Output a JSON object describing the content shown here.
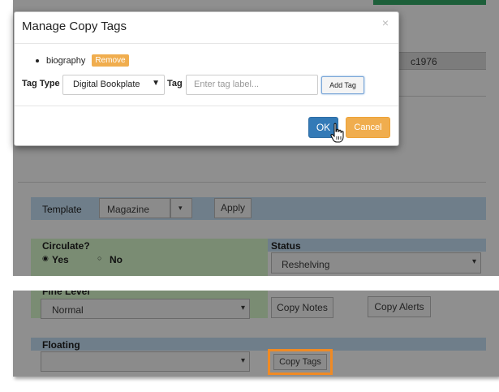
{
  "modal": {
    "title": "Manage Copy Tags",
    "close": "×",
    "tag": {
      "label": "biography",
      "remove": "Remove"
    },
    "tag_type_label": "Tag Type",
    "tag_type_value": "Digital Bookplate",
    "tag_label": "Tag",
    "tag_placeholder": "Enter tag label...",
    "add_tag": "Add Tag",
    "ok": "OK",
    "cancel": "Cancel"
  },
  "background": {
    "grid_value": "c1976",
    "template_label": "Template",
    "template_value": "Magazine",
    "apply": "Apply",
    "circulate_label": "Circulate?",
    "yes": "Yes",
    "no": "No",
    "status_label": "Status",
    "status_value": "Reshelving",
    "fine_level_label": "Fine Level",
    "fine_level_value": "Normal",
    "copy_notes": "Copy Notes",
    "copy_alerts": "Copy Alerts",
    "floating_label": "Floating",
    "copy_tags": "Copy Tags"
  },
  "colors": {
    "primary": "#337ab7",
    "warning": "#f0ad4e",
    "highlight": "#f08a24"
  }
}
